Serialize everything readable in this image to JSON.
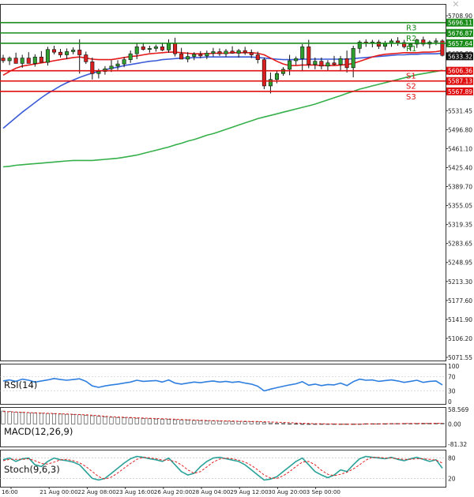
{
  "window": {
    "close_icon": "close-icon"
  },
  "colors": {
    "bull": "#2e9e2e",
    "bear": "#d92020",
    "resistance": "#1a8c1a",
    "support": "#e01010",
    "ma_fast": "#e41a1a",
    "ma_mid": "#3b5bd8",
    "ma_slow": "#36b04a",
    "osc_line": "#2f7fe0",
    "osc_signal": "#e02020",
    "axis_text": "#222222",
    "grid": "#d8d8d8"
  },
  "chart_data": [
    {
      "type": "candlestick",
      "title": "",
      "y_ticks": [
        "5708.90",
        "5673.85",
        "5638.80",
        "5602.75",
        "5567.20",
        "5531.45",
        "5496.80",
        "5461.10",
        "5425.40",
        "5389.70",
        "5355.05",
        "5319.35",
        "5283.65",
        "5248.95",
        "5213.30",
        "5177.60",
        "5141.90",
        "5106.20",
        "5071.55"
      ],
      "ylim": [
        5071.55,
        5708.9
      ],
      "x_ticks": [
        "16:00",
        "21 Aug 00:00",
        "22 Aug 08:00",
        "23 Aug 16:00",
        "26 Aug 20:00",
        "28 Aug 04:00",
        "29 Aug 12:00",
        "30 Aug 20:00",
        "3 Sep 00:00"
      ],
      "levels": [
        {
          "name": "R3",
          "value": 5696.11,
          "label": "5696.11",
          "kind": "resistance"
        },
        {
          "name": "R2",
          "value": 5676.87,
          "label": "5676.87",
          "kind": "resistance"
        },
        {
          "name": "R1",
          "value": 5657.64,
          "label": "5657.64",
          "kind": "resistance"
        },
        {
          "name": "S1",
          "value": 5606.36,
          "label": "5606.36",
          "kind": "support"
        },
        {
          "name": "S2",
          "value": 5587.13,
          "label": "5587.13",
          "kind": "support"
        },
        {
          "name": "S3",
          "value": 5567.89,
          "label": "5567.89",
          "kind": "support"
        }
      ],
      "current_price": {
        "value": 5633.32,
        "label": "5633.32"
      },
      "candles": [
        [
          5630,
          5636,
          5621,
          5625
        ],
        [
          5625,
          5633,
          5617,
          5630
        ],
        [
          5630,
          5640,
          5624,
          5620
        ],
        [
          5620,
          5636,
          5612,
          5630
        ],
        [
          5630,
          5641,
          5622,
          5620
        ],
        [
          5620,
          5637,
          5614,
          5632
        ],
        [
          5632,
          5643,
          5626,
          5622
        ],
        [
          5622,
          5651,
          5616,
          5646
        ],
        [
          5646,
          5653,
          5637,
          5641
        ],
        [
          5641,
          5647,
          5631,
          5636
        ],
        [
          5636,
          5648,
          5628,
          5642
        ],
        [
          5642,
          5650,
          5637,
          5645
        ],
        [
          5645,
          5665,
          5601,
          5636
        ],
        [
          5636,
          5642,
          5619,
          5623
        ],
        [
          5623,
          5631,
          5590,
          5601
        ],
        [
          5601,
          5610,
          5592,
          5605
        ],
        [
          5605,
          5615,
          5599,
          5610
        ],
        [
          5610,
          5626,
          5604,
          5615
        ],
        [
          5615,
          5626,
          5608,
          5619
        ],
        [
          5619,
          5632,
          5613,
          5627
        ],
        [
          5627,
          5644,
          5621,
          5638
        ],
        [
          5638,
          5657,
          5628,
          5651
        ],
        [
          5651,
          5659,
          5644,
          5646
        ],
        [
          5646,
          5653,
          5640,
          5648
        ],
        [
          5648,
          5655,
          5642,
          5651
        ],
        [
          5651,
          5657,
          5643,
          5645
        ],
        [
          5645,
          5665,
          5640,
          5658
        ],
        [
          5658,
          5668,
          5633,
          5638
        ],
        [
          5638,
          5649,
          5631,
          5628
        ],
        [
          5628,
          5641,
          5622,
          5633
        ],
        [
          5633,
          5641,
          5626,
          5637
        ],
        [
          5637,
          5643,
          5630,
          5634
        ],
        [
          5634,
          5644,
          5628,
          5639
        ],
        [
          5639,
          5649,
          5633,
          5642
        ],
        [
          5642,
          5648,
          5634,
          5638
        ],
        [
          5638,
          5647,
          5632,
          5643
        ],
        [
          5643,
          5652,
          5638,
          5639
        ],
        [
          5639,
          5647,
          5631,
          5644
        ],
        [
          5644,
          5651,
          5636,
          5640
        ],
        [
          5640,
          5646,
          5630,
          5636
        ],
        [
          5636,
          5642,
          5620,
          5627
        ],
        [
          5627,
          5631,
          5572,
          5578
        ],
        [
          5578,
          5603,
          5564,
          5590
        ],
        [
          5590,
          5606,
          5583,
          5601
        ],
        [
          5601,
          5613,
          5597,
          5609
        ],
        [
          5609,
          5636,
          5598,
          5625
        ],
        [
          5625,
          5633,
          5617,
          5629
        ],
        [
          5629,
          5656,
          5605,
          5651
        ],
        [
          5651,
          5664,
          5611,
          5618
        ],
        [
          5618,
          5631,
          5609,
          5624
        ],
        [
          5624,
          5631,
          5609,
          5615
        ],
        [
          5615,
          5626,
          5606,
          5621
        ],
        [
          5621,
          5634,
          5616,
          5618
        ],
        [
          5618,
          5634,
          5605,
          5629
        ],
        [
          5629,
          5644,
          5603,
          5612
        ],
        [
          5612,
          5653,
          5594,
          5648
        ],
        [
          5648,
          5663,
          5639,
          5660
        ],
        [
          5660,
          5665,
          5651,
          5657
        ],
        [
          5657,
          5664,
          5650,
          5660
        ],
        [
          5660,
          5664,
          5647,
          5652
        ],
        [
          5652,
          5662,
          5645,
          5657
        ],
        [
          5657,
          5666,
          5651,
          5662
        ],
        [
          5662,
          5669,
          5653,
          5659
        ],
        [
          5659,
          5664,
          5648,
          5651
        ],
        [
          5651,
          5658,
          5643,
          5656
        ],
        [
          5656,
          5666,
          5649,
          5664
        ],
        [
          5664,
          5670,
          5652,
          5656
        ],
        [
          5656,
          5663,
          5648,
          5660
        ],
        [
          5660,
          5667,
          5654,
          5662
        ],
        [
          5662,
          5665,
          5633,
          5635
        ]
      ],
      "ma_fast": [
        5598,
        5605,
        5611,
        5615,
        5617,
        5619,
        5621,
        5623,
        5625,
        5627,
        5629,
        5631,
        5632,
        5630,
        5628,
        5627,
        5627,
        5627,
        5629,
        5631,
        5633,
        5634,
        5636,
        5638,
        5639,
        5640,
        5641,
        5641,
        5640,
        5639,
        5638,
        5638,
        5638,
        5639,
        5639,
        5639,
        5640,
        5640,
        5640,
        5640,
        5639,
        5636,
        5630,
        5624,
        5619,
        5616,
        5616,
        5617,
        5617,
        5617,
        5616,
        5616,
        5616,
        5617,
        5618,
        5620,
        5624,
        5628,
        5632,
        5635,
        5637,
        5638,
        5639,
        5640,
        5640,
        5640,
        5641,
        5641,
        5642,
        5644
      ],
      "ma_mid": [
        5499,
        5509,
        5519,
        5529,
        5538,
        5547,
        5556,
        5564,
        5571,
        5578,
        5584,
        5589,
        5594,
        5598,
        5602,
        5605,
        5608,
        5611,
        5613,
        5616,
        5618,
        5620,
        5622,
        5624,
        5625,
        5627,
        5628,
        5629,
        5630,
        5630,
        5631,
        5631,
        5632,
        5632,
        5632,
        5632,
        5632,
        5632,
        5632,
        5632,
        5631,
        5630,
        5629,
        5628,
        5627,
        5627,
        5627,
        5628,
        5628,
        5628,
        5628,
        5628,
        5628,
        5628,
        5628,
        5629,
        5630,
        5631,
        5632,
        5633,
        5634,
        5635,
        5636,
        5636,
        5637,
        5637,
        5638,
        5638,
        5638,
        5639
      ],
      "ma_slow": [
        5427,
        5428,
        5430,
        5431,
        5432,
        5433,
        5434,
        5435,
        5436,
        5437,
        5438,
        5439,
        5439,
        5439,
        5439,
        5440,
        5441,
        5442,
        5443,
        5445,
        5447,
        5449,
        5452,
        5455,
        5458,
        5461,
        5464,
        5468,
        5471,
        5475,
        5478,
        5482,
        5486,
        5489,
        5493,
        5497,
        5501,
        5505,
        5509,
        5513,
        5517,
        5520,
        5523,
        5526,
        5529,
        5532,
        5535,
        5538,
        5541,
        5544,
        5548,
        5552,
        5556,
        5560,
        5564,
        5568,
        5572,
        5575,
        5578,
        5581,
        5584,
        5587,
        5590,
        5593,
        5596,
        5599,
        5601,
        5603,
        5605,
        5607
      ]
    },
    {
      "type": "line",
      "title": "RSI(14)",
      "y_ticks": [
        "100",
        "70",
        "30",
        "0"
      ],
      "ylim": [
        0,
        100
      ],
      "series": [
        {
          "values": [
            58,
            61,
            57,
            63,
            60,
            55,
            58,
            61,
            65,
            62,
            60,
            62,
            64,
            57,
            44,
            40,
            44,
            47,
            49,
            52,
            55,
            60,
            57,
            58,
            59,
            55,
            61,
            52,
            49,
            52,
            55,
            53,
            56,
            58,
            55,
            57,
            54,
            56,
            52,
            49,
            43,
            30,
            35,
            39,
            43,
            47,
            50,
            56,
            46,
            49,
            45,
            48,
            47,
            52,
            45,
            56,
            63,
            60,
            61,
            57,
            59,
            61,
            58,
            54,
            57,
            60,
            54,
            57,
            58,
            47
          ]
        }
      ]
    },
    {
      "type": "bar",
      "title": "MACD(12,26,9)",
      "y_ticks": [
        "58.569",
        "0.00",
        "-81.32"
      ],
      "ylim": [
        -81.32,
        58.569
      ],
      "series": [
        {
          "name": "macd",
          "values": [
            52,
            50,
            48,
            46,
            45,
            44,
            43,
            42,
            41,
            40,
            39,
            38,
            37,
            35,
            33,
            31,
            29,
            27,
            26,
            25,
            24,
            23,
            22,
            21,
            20,
            19,
            18,
            17,
            16,
            15,
            14,
            13,
            12,
            12,
            11,
            11,
            10,
            10,
            9,
            9,
            8,
            6,
            4,
            3,
            2,
            1,
            1,
            0,
            0,
            -1,
            -1,
            -1,
            -1,
            -1,
            -1,
            0,
            0,
            1,
            1,
            1,
            1,
            2,
            2,
            2,
            2,
            2,
            3,
            3,
            3,
            3
          ]
        },
        {
          "name": "signal",
          "values": [
            50,
            49,
            48,
            47,
            46,
            45,
            44,
            43,
            42,
            41,
            40,
            39,
            38,
            37,
            35,
            33,
            31,
            29,
            28,
            27,
            26,
            25,
            24,
            23,
            22,
            21,
            20,
            19,
            18,
            17,
            16,
            15,
            14,
            13,
            13,
            12,
            12,
            11,
            11,
            10,
            10,
            9,
            8,
            7,
            6,
            5,
            4,
            3,
            2,
            1,
            1,
            0,
            0,
            -1,
            -1,
            -1,
            -1,
            0,
            0,
            0,
            1,
            1,
            1,
            2,
            2,
            2,
            2,
            2,
            3,
            3
          ]
        }
      ]
    },
    {
      "type": "line",
      "title": "Stoch(9,6,3)",
      "y_ticks": [
        "80",
        "20"
      ],
      "ylim": [
        0,
        100
      ],
      "series": [
        {
          "name": "main",
          "values": [
            75,
            80,
            70,
            78,
            80,
            60,
            55,
            70,
            80,
            75,
            72,
            68,
            60,
            40,
            20,
            15,
            20,
            35,
            50,
            65,
            78,
            85,
            82,
            78,
            75,
            70,
            80,
            60,
            40,
            30,
            35,
            55,
            70,
            80,
            82,
            78,
            74,
            70,
            60,
            45,
            30,
            15,
            18,
            25,
            40,
            55,
            70,
            80,
            60,
            40,
            30,
            22,
            30,
            45,
            40,
            60,
            78,
            85,
            82,
            80,
            78,
            82,
            76,
            72,
            78,
            82,
            76,
            70,
            75,
            50
          ]
        },
        {
          "name": "signal",
          "values": [
            72,
            76,
            76,
            76,
            78,
            72,
            64,
            62,
            68,
            75,
            76,
            72,
            66,
            55,
            40,
            25,
            18,
            24,
            36,
            50,
            64,
            76,
            82,
            81,
            78,
            74,
            74,
            70,
            60,
            45,
            35,
            40,
            54,
            68,
            77,
            80,
            78,
            74,
            68,
            58,
            45,
            30,
            21,
            20,
            28,
            40,
            55,
            68,
            70,
            60,
            44,
            32,
            28,
            32,
            38,
            48,
            60,
            74,
            82,
            82,
            80,
            80,
            78,
            76,
            76,
            78,
            78,
            76,
            74,
            65
          ]
        }
      ]
    }
  ]
}
